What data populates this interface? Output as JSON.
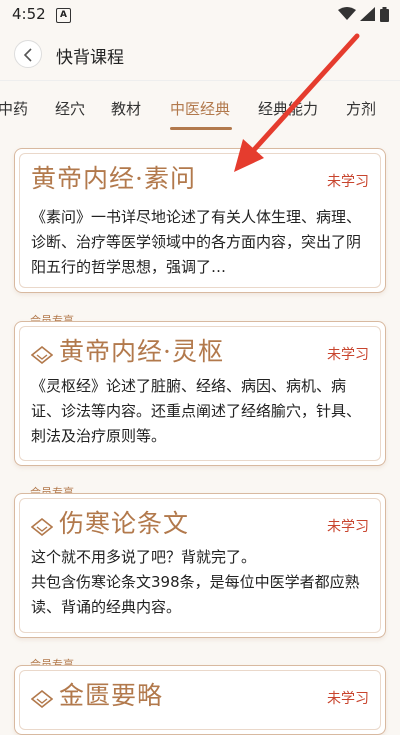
{
  "status_bar": {
    "time": "4:52",
    "notification_icon": "A"
  },
  "header": {
    "title": "快背课程"
  },
  "tabs": [
    {
      "label": "中药"
    },
    {
      "label": "经穴"
    },
    {
      "label": "教材"
    },
    {
      "label": "中医经典"
    },
    {
      "label": "经典能力"
    },
    {
      "label": "方剂"
    }
  ],
  "active_tab": "中医经典",
  "cards": [
    {
      "title": "黄帝内经·素问",
      "status": "未学习",
      "description": "《素问》一书详尽地论述了有关人体生理、病理、诊断、治疗等医学领域中的各方面内容，突出了阴阳五行的哲学思想，强调了…"
    },
    {
      "member_tag": "会员专享",
      "title": "黄帝内经·灵枢",
      "status": "未学习",
      "description": "《灵枢经》论述了脏腑、经络、病因、病机、病证、诊法等内容。还重点阐述了经络腧穴，针具、刺法及治疗原则等。"
    },
    {
      "member_tag": "会员专享",
      "title": "伤寒论条文",
      "status": "未学习",
      "description_line1": "这个就不用多说了吧？背就完了。",
      "description_line2": "共包含伤寒论条文398条，是每位中医学者都应熟读、背诵的经典内容。"
    },
    {
      "member_tag": "会员专享",
      "title": "金匮要略",
      "status": "未学习"
    }
  ],
  "colors": {
    "accent": "#b2794c",
    "status_red": "#c8442d",
    "arrow_red": "#e53c2e"
  }
}
